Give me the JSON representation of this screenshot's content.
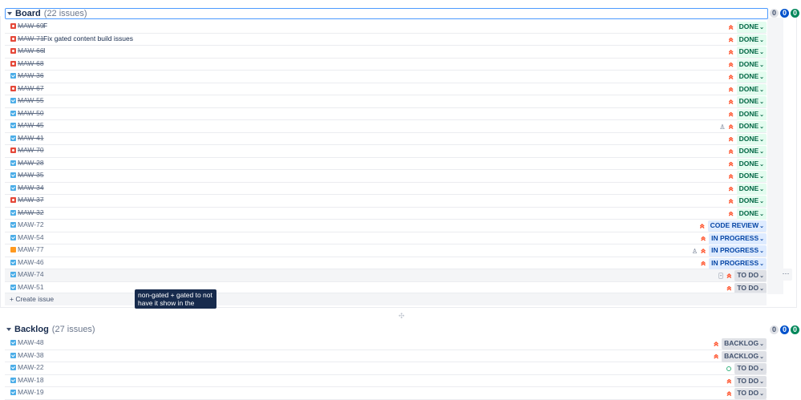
{
  "board": {
    "title": "Board",
    "count": "(22 issues)",
    "counts": {
      "todo": "0",
      "inprogress": "0",
      "done": "0"
    },
    "issues": [
      {
        "key": "MAW-69",
        "type": "bug",
        "summary": "F",
        "status": "DONE",
        "done": true
      },
      {
        "key": "MAW-71",
        "type": "bug",
        "summary": "Fix gated content build issues",
        "status": "DONE",
        "done": true
      },
      {
        "key": "MAW-66",
        "type": "bug",
        "summary": "I",
        "status": "DONE",
        "done": true
      },
      {
        "key": "MAW-68",
        "type": "bug",
        "summary": "",
        "status": "DONE",
        "done": true
      },
      {
        "key": "MAW-36",
        "type": "task",
        "summary": "",
        "status": "DONE",
        "done": true
      },
      {
        "key": "MAW-67",
        "type": "bug",
        "summary": "",
        "status": "DONE",
        "done": true
      },
      {
        "key": "MAW-55",
        "type": "task",
        "summary": "",
        "status": "DONE",
        "done": true
      },
      {
        "key": "MAW-50",
        "type": "task",
        "summary": "",
        "status": "DONE",
        "done": true
      },
      {
        "key": "MAW-45",
        "type": "task",
        "summary": "",
        "status": "DONE",
        "done": true,
        "extra": "ast"
      },
      {
        "key": "MAW-41",
        "type": "task",
        "summary": "",
        "status": "DONE",
        "done": true
      },
      {
        "key": "MAW-70",
        "type": "bug",
        "summary": "",
        "status": "DONE",
        "done": true
      },
      {
        "key": "MAW-28",
        "type": "task",
        "summary": "",
        "status": "DONE",
        "done": true
      },
      {
        "key": "MAW-35",
        "type": "task",
        "summary": "",
        "status": "DONE",
        "done": true
      },
      {
        "key": "MAW-34",
        "type": "task",
        "summary": "",
        "status": "DONE",
        "done": true
      },
      {
        "key": "MAW-37",
        "type": "bug",
        "summary": "",
        "status": "DONE",
        "done": true
      },
      {
        "key": "MAW-32",
        "type": "task",
        "summary": "",
        "status": "DONE",
        "done": true
      },
      {
        "key": "MAW-72",
        "type": "task",
        "summary": "",
        "status": "CODE REVIEW",
        "done": false
      },
      {
        "key": "MAW-54",
        "type": "task",
        "summary": "",
        "status": "IN PROGRESS",
        "done": false
      },
      {
        "key": "MAW-77",
        "type": "story",
        "summary": "",
        "status": "IN PROGRESS",
        "done": false,
        "extra": "ast"
      },
      {
        "key": "MAW-46",
        "type": "task",
        "summary": "",
        "status": "IN PROGRESS",
        "done": false
      },
      {
        "key": "MAW-74",
        "type": "task",
        "summary": "",
        "status": "TO DO",
        "done": false,
        "extra": "minus",
        "gray": true
      },
      {
        "key": "MAW-51",
        "type": "task",
        "summary": "",
        "status": "TO DO",
        "done": false
      }
    ],
    "create_label": "+ Create issue",
    "tooltip": "non-gated + gated to not have it show in the resources Generic Index",
    "more": "···"
  },
  "backlog": {
    "title": "Backlog",
    "count": "(27 issues)",
    "counts": {
      "todo": "0",
      "inprogress": "0",
      "done": "0"
    },
    "issues": [
      {
        "key": "MAW-48",
        "type": "task",
        "status": "BACKLOG",
        "prio": "high"
      },
      {
        "key": "MAW-38",
        "type": "task",
        "status": "BACKLOG",
        "prio": "high"
      },
      {
        "key": "MAW-22",
        "type": "task",
        "status": "TO DO",
        "prio": "low"
      },
      {
        "key": "MAW-18",
        "type": "task",
        "status": "TO DO",
        "prio": "high"
      },
      {
        "key": "MAW-19",
        "type": "task",
        "status": "TO DO",
        "prio": "high"
      }
    ]
  },
  "colors": {
    "done": "#006644",
    "blue": "#0747a6",
    "accent": "#4c9aff"
  },
  "icons": {
    "priority": "arrow-up-icon",
    "task": "checkbox-icon",
    "bug": "bug-icon",
    "story": "story-icon"
  }
}
